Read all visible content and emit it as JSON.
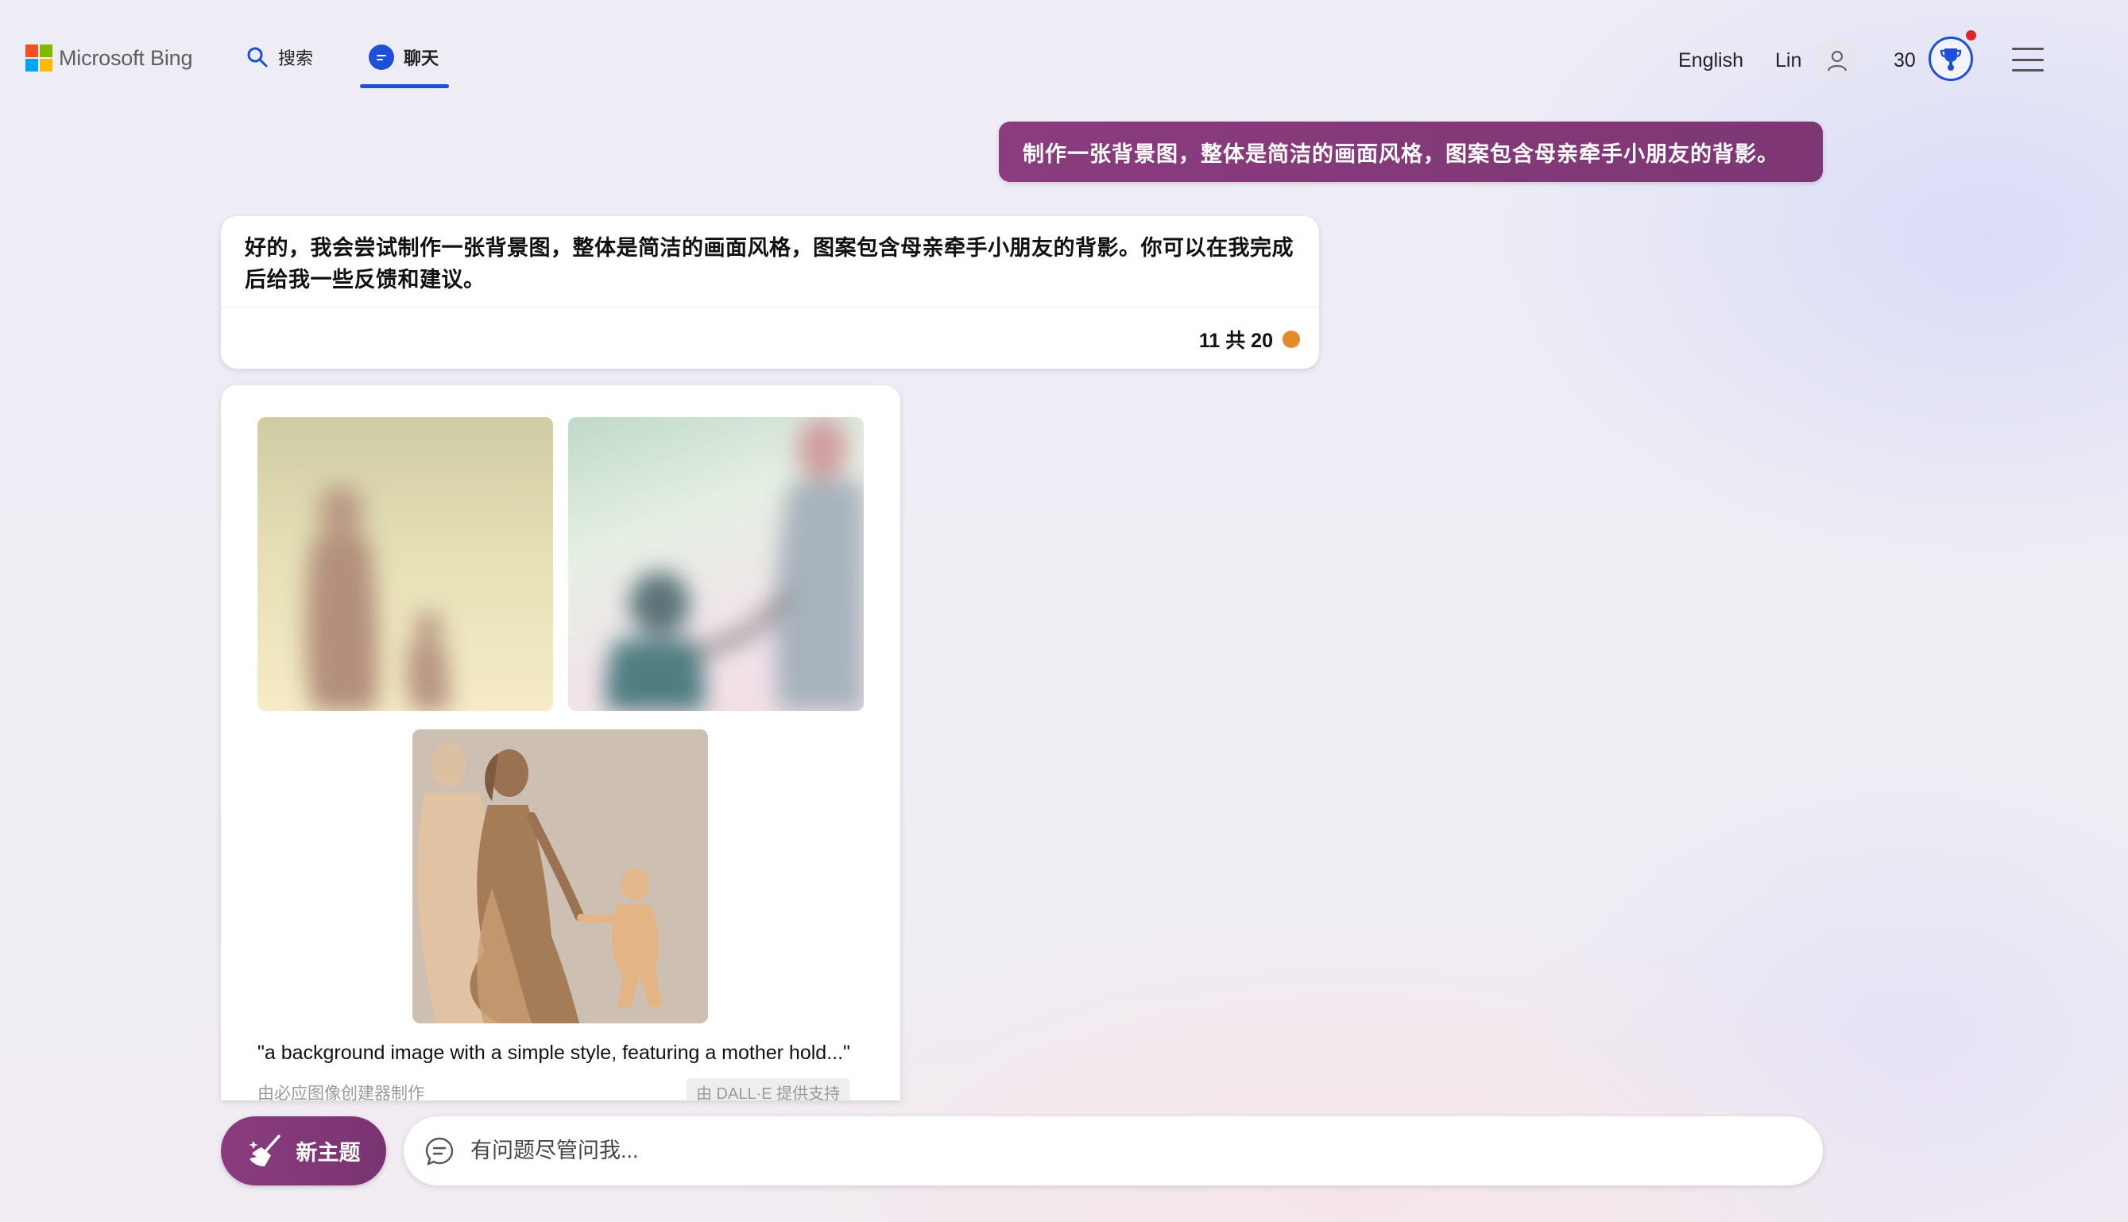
{
  "header": {
    "logo_text": "Microsoft Bing",
    "nav": [
      {
        "label": "搜索",
        "icon": "search-icon"
      },
      {
        "label": "聊天",
        "icon": "chat-icon",
        "active": true
      }
    ],
    "language": "English",
    "user_name": "Lin",
    "points": "30",
    "colors": {
      "accent": "#1e4fd8",
      "notification": "#e0242e"
    }
  },
  "conversation": {
    "user_message": "制作一张背景图，整体是简洁的画面风格，图案包含母亲牵手小朋友的背影。",
    "bot_reply": "好的，我会尝试制作一张背景图，整体是简洁的画面风格，图案包含母亲牵手小朋友的背影。你可以在我完成后给我一些反馈和建议。",
    "turn_counter": "11 共 20",
    "colors": {
      "user_bubble": "#8a3c7e",
      "counter_dot": "#e58a2b"
    }
  },
  "image_result": {
    "caption": "\"a background image with a simple style, featuring a mother hold...\"",
    "credit_left": "由必应图像创建器制作",
    "credit_right": "由 DALL·E 提供支持",
    "images": [
      "generated-image-1",
      "generated-image-2",
      "generated-image-3"
    ]
  },
  "composer": {
    "new_topic_label": "新主题",
    "placeholder": "有问题尽管问我..."
  }
}
